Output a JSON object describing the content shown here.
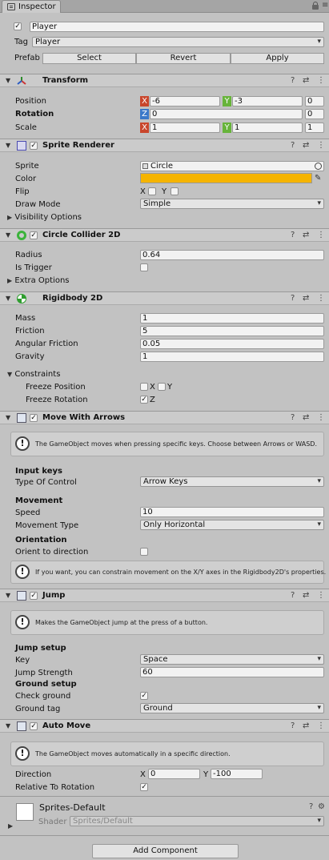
{
  "tab": {
    "title": "Inspector",
    "lock_icon": "lock-icon",
    "menu_icon": "menu-icon"
  },
  "gameobject": {
    "name": "Player",
    "tag_label": "Tag",
    "tag_value": "Player",
    "prefab_label": "Prefab",
    "select_label": "Select",
    "revert_label": "Revert",
    "apply_label": "Apply"
  },
  "transform": {
    "title": "Transform",
    "position_label": "Position",
    "position_x": "-6",
    "position_y": "-3",
    "position_z": "0",
    "rotation_label": "Rotation",
    "rotation_z": "0",
    "rotation_w": "0",
    "scale_label": "Scale",
    "scale_x": "1",
    "scale_y": "1",
    "scale_z": "1",
    "axis_x": "X",
    "axis_y": "Y",
    "axis_z": "Z"
  },
  "sprite_renderer": {
    "title": "Sprite Renderer",
    "sprite_label": "Sprite",
    "sprite_value": "Circle",
    "color_label": "Color",
    "color_value": "#f5b400",
    "flip_label": "Flip",
    "flip_x": "X",
    "flip_y": "Y",
    "draw_mode_label": "Draw Mode",
    "draw_mode_value": "Simple",
    "visibility_label": "Visibility Options"
  },
  "circle_collider": {
    "title": "Circle Collider 2D",
    "radius_label": "Radius",
    "radius_value": "0.64",
    "is_trigger_label": "Is Trigger",
    "extra_label": "Extra Options"
  },
  "rigidbody": {
    "title": "Rigidbody 2D",
    "mass_label": "Mass",
    "mass_value": "1",
    "friction_label": "Friction",
    "friction_value": "5",
    "angular_label": "Angular Friction",
    "angular_value": "0.05",
    "gravity_label": "Gravity",
    "gravity_value": "1",
    "constraints_label": "Constraints",
    "freeze_pos_label": "Freeze Position",
    "freeze_rot_label": "Freeze Rotation",
    "x_label": "X",
    "y_label": "Y",
    "z_label": "Z"
  },
  "move_with_arrows": {
    "title": "Move With Arrows",
    "info": "The GameObject moves when pressing specific keys. Choose between Arrows or WASD.",
    "input_keys_label": "Input keys",
    "type_label": "Type Of Control",
    "type_value": "Arrow Keys",
    "movement_label": "Movement",
    "speed_label": "Speed",
    "speed_value": "10",
    "movement_type_label": "Movement Type",
    "movement_type_value": "Only Horizontal",
    "orientation_label": "Orientation",
    "orient_label": "Orient to direction",
    "info2": "If you want, you can constrain movement on the X/Y axes in the Rigidbody2D's properties."
  },
  "jump": {
    "title": "Jump",
    "info": "Makes the GameObject jump at the press of a button.",
    "setup_label": "Jump setup",
    "key_label": "Key",
    "key_value": "Space",
    "strength_label": "Jump Strength",
    "strength_value": "60",
    "ground_setup_label": "Ground setup",
    "check_ground_label": "Check ground",
    "ground_tag_label": "Ground tag",
    "ground_tag_value": "Ground"
  },
  "auto_move": {
    "title": "Auto Move",
    "info": "The GameObject moves automatically in a specific direction.",
    "direction_label": "Direction",
    "dir_x_label": "X",
    "dir_x": "0",
    "dir_y_label": "Y",
    "dir_y": "-100",
    "relative_label": "Relative To Rotation"
  },
  "material": {
    "name": "Sprites-Default",
    "shader_label": "Shader",
    "shader_value": "Sprites/Default"
  },
  "add_component_label": "Add Component",
  "check_mark": "✓",
  "info_mark": "!",
  "header_icons": {
    "help": "?",
    "settings": "⇄",
    "menu": "⋮"
  }
}
